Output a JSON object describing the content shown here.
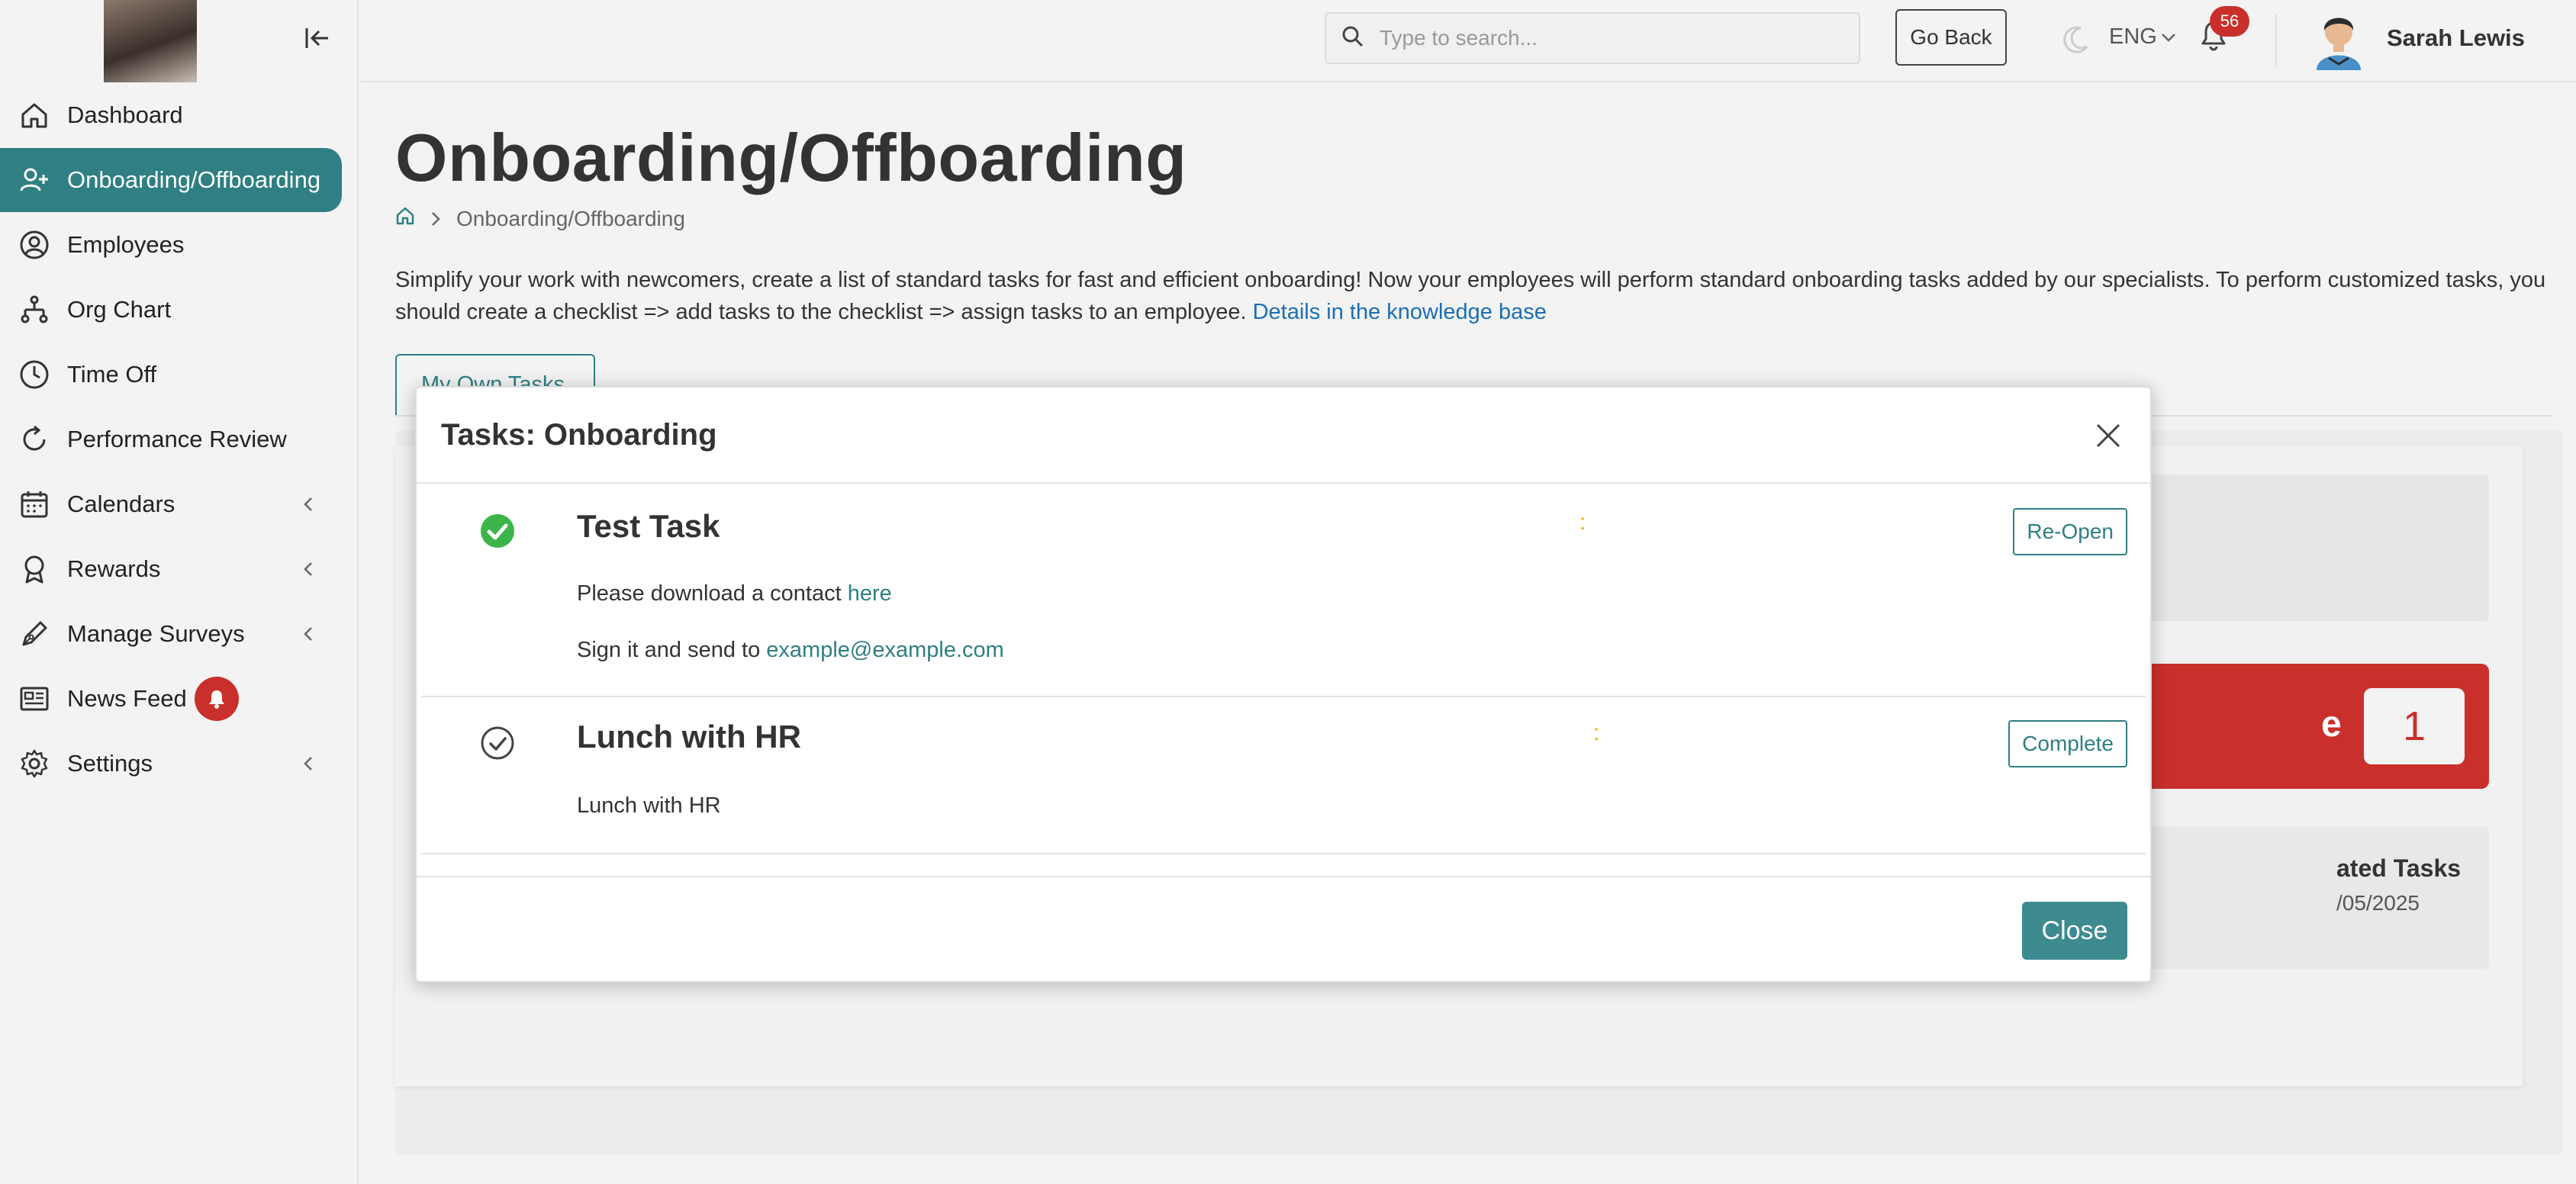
{
  "sidebar": {
    "items": [
      {
        "label": "Dashboard",
        "icon": "home-icon"
      },
      {
        "label": "Onboarding/Offboarding",
        "icon": "user-plus-icon",
        "active": true
      },
      {
        "label": "Employees",
        "icon": "user-circle-icon"
      },
      {
        "label": "Org Chart",
        "icon": "org-chart-icon"
      },
      {
        "label": "Time Off",
        "icon": "clock-icon"
      },
      {
        "label": "Performance Review",
        "icon": "refresh-icon"
      },
      {
        "label": "Calendars",
        "icon": "calendar-icon",
        "has_submenu": true
      },
      {
        "label": "Rewards",
        "icon": "award-icon",
        "has_submenu": true
      },
      {
        "label": "Manage Surveys",
        "icon": "pen-icon",
        "has_submenu": true
      },
      {
        "label": "News Feed",
        "icon": "newspaper-icon",
        "badge_icon": "bell-icon"
      },
      {
        "label": "Settings",
        "icon": "gear-icon",
        "has_submenu": true
      }
    ]
  },
  "topbar": {
    "search_placeholder": "Type to search...",
    "go_back": "Go Back",
    "language": "ENG",
    "notifications_count": "56",
    "user_name": "Sarah Lewis"
  },
  "page": {
    "title": "Onboarding/Offboarding",
    "breadcrumb": "Onboarding/Offboarding",
    "description": "Simplify your work with newcomers, create a list of standard tasks for fast and efficient onboarding! Now your employees will perform standard onboarding tasks added by our specialists. To perform customized tasks, you should create a checklist => add tasks to the checklist => assign tasks to an employee.",
    "description_link": "Details in the knowledge base",
    "tab_label": "My Own Tasks"
  },
  "background_cards": {
    "red_label": "e",
    "red_count": "1",
    "info_title": "ated Tasks",
    "info_date": "/05/2025"
  },
  "modal": {
    "title": "Tasks: Onboarding",
    "tasks": [
      {
        "title": "Test Task",
        "status": "completed",
        "dots": ":",
        "line1_prefix": "Please download a contact",
        "line1_link": "here",
        "line2_prefix": "Sign it and send to",
        "line2_link": "example@example.com",
        "button": "Re-Open"
      },
      {
        "title": "Lunch with HR",
        "status": "pending",
        "dots": ":",
        "line1_prefix": "Lunch with HR",
        "button": "Complete"
      }
    ],
    "close_label": "Close"
  },
  "colors": {
    "accent": "#2f7f83",
    "danger": "#c9302c",
    "success": "#3bb54a",
    "link": "#1a6fb8"
  }
}
